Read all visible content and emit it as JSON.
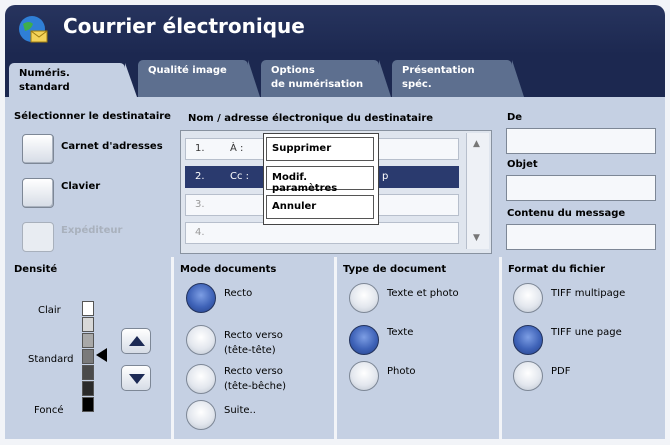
{
  "window": {
    "title": "Courrier électronique"
  },
  "tabs": [
    {
      "label": "Numéris. standard"
    },
    {
      "label": "Qualité image"
    },
    {
      "label": "Options\nde numérisation"
    },
    {
      "label": "Présentation spéc."
    }
  ],
  "recipient_selection": {
    "title": "Sélectionner le destinataire",
    "address_book_label": "Carnet d'adresses",
    "keyboard_label": "Clavier",
    "sender_label": "Expéditeur"
  },
  "recipients": {
    "header": "Nom / adresse électronique du destinataire",
    "rows": [
      {
        "num": "1.",
        "kind": "À :"
      },
      {
        "num": "2.",
        "kind": "Cc :",
        "trailing": "p"
      },
      {
        "num": "3.",
        "kind": ""
      },
      {
        "num": "4.",
        "kind": ""
      }
    ]
  },
  "context_menu": {
    "items": [
      "Supprimer",
      "Modif. paramètres",
      "Annuler"
    ]
  },
  "message": {
    "from_label": "De",
    "subject_label": "Objet",
    "body_label": "Contenu du message"
  },
  "density": {
    "title": "Densité",
    "light_label": "Clair",
    "standard_label": "Standard",
    "dark_label": "Foncé",
    "bar_colors": [
      "#ffffff",
      "#d8d8d8",
      "#a8a8a8",
      "#7a7a7a",
      "#4a4a4a",
      "#2a2a2a",
      "#000000"
    ],
    "level": "Standard"
  },
  "document_mode": {
    "title": "Mode documents",
    "options": [
      "Recto",
      "Recto verso\n(tête-tête)",
      "Recto verso\n(tête-bêche)",
      "Suite.."
    ],
    "selected": "Recto"
  },
  "document_type": {
    "title": "Type de document",
    "options": [
      "Texte et photo",
      "Texte",
      "Photo"
    ],
    "selected": "Texte"
  },
  "file_format": {
    "title": "Format du fichier",
    "options": [
      "TIFF multipage",
      "TIFF une page",
      "PDF"
    ],
    "selected": "TIFF une page"
  },
  "colors": {
    "titlebar": "#1c2850",
    "panel": "#c5d0e3",
    "selected": "#2a3a6e"
  }
}
